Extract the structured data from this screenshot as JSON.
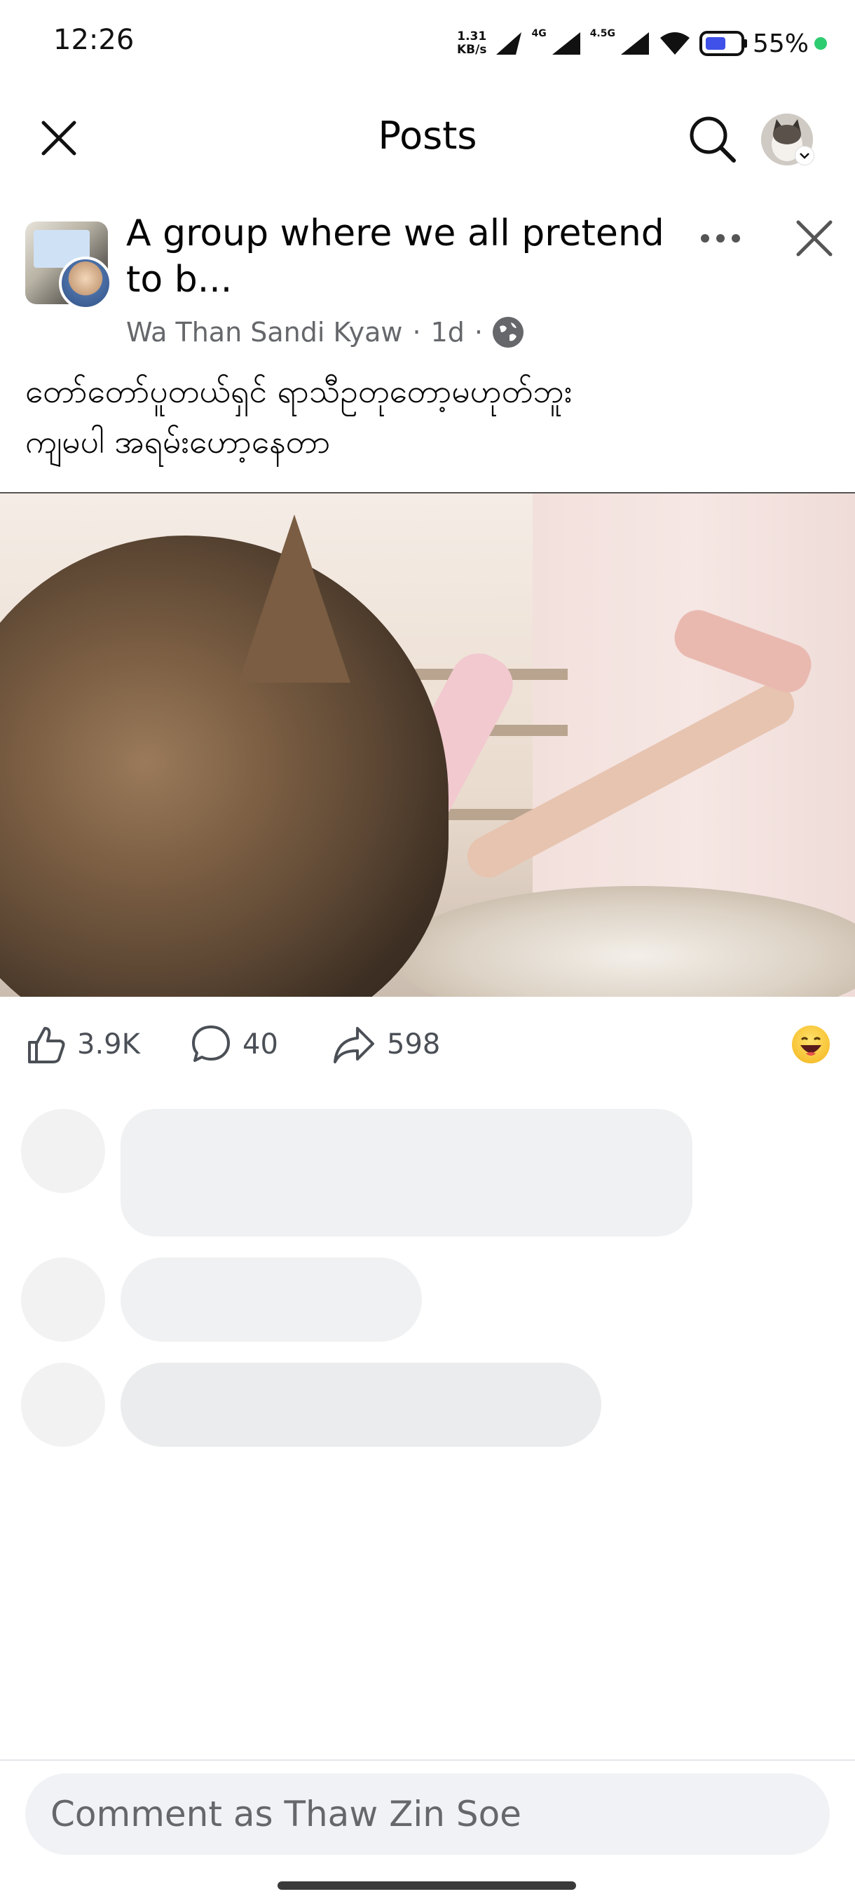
{
  "status_bar": {
    "time": "12:26",
    "net_speed_value": "1.31",
    "net_speed_unit": "KB/s",
    "network_1": "4G",
    "network_2": "4.5G",
    "battery_percent": "55%",
    "icons": [
      "signal-icon",
      "wifi-icon",
      "battery-icon"
    ]
  },
  "header": {
    "title": "Posts",
    "icons": [
      "close-icon",
      "search-icon",
      "profile-avatar"
    ]
  },
  "post": {
    "group_name": "A group where we all pretend to b...",
    "author": "Wa Than Sandi Kyaw",
    "separator": "·",
    "time": "1d",
    "privacy_icon": "globe-icon",
    "caption_line1": "တော်တော်ပူတယ်ရှင် ရာသီဥတုတော့မဟုတ်ဘူး",
    "caption_line2": "ကျမပါ အရမ်းဟော့နေတာ",
    "likes": "3.9K",
    "comments": "40",
    "shares": "598",
    "reaction_icon": "laughing-emoji-icon"
  },
  "comment_bar": {
    "placeholder": "Comment as Thaw Zin Soe"
  },
  "colors": {
    "text_primary": "#050505",
    "text_secondary": "#65676b",
    "skeleton": "#f0f1f2",
    "online_dot": "#2ecc71"
  }
}
